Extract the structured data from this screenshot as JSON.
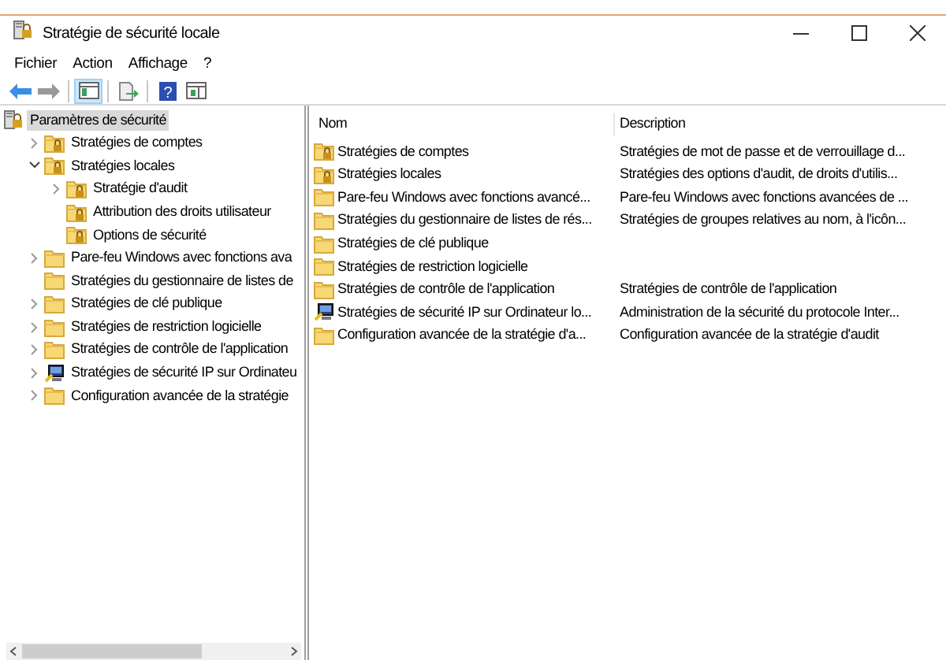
{
  "window": {
    "title": "Stratégie de sécurité locale"
  },
  "menu": [
    "Fichier",
    "Action",
    "Affichage",
    "?"
  ],
  "toolbar": [
    [
      {
        "kind": "back",
        "enabled": true,
        "pressed": false
      },
      {
        "kind": "forward",
        "enabled": false,
        "pressed": false
      }
    ],
    [
      {
        "kind": "tree",
        "enabled": true,
        "pressed": true
      }
    ],
    [
      {
        "kind": "export",
        "enabled": true,
        "pressed": false
      }
    ],
    [
      {
        "kind": "help",
        "label": "?",
        "enabled": true,
        "pressed": false
      },
      {
        "kind": "panel",
        "enabled": true,
        "pressed": false
      }
    ]
  ],
  "tree": {
    "label": "Paramètres de sécurité",
    "kind": "security",
    "selected": true,
    "children": [
      {
        "label": "Stratégies de comptes",
        "kind": "locked",
        "selected": false,
        "expanded": false
      },
      {
        "label": "Stratégies locales",
        "kind": "locked",
        "selected": false,
        "expanded": true,
        "children": [
          {
            "label": "Stratégie d'audit",
            "kind": "locked",
            "selected": false,
            "expanded": false
          },
          {
            "label": "Attribution des droits utilisateur",
            "kind": "locked",
            "selected": false
          },
          {
            "label": "Options de sécurité",
            "kind": "locked",
            "selected": false
          }
        ]
      },
      {
        "label": "Pare-feu Windows avec fonctions ava",
        "kind": "folder",
        "selected": false,
        "expanded": false
      },
      {
        "label": "Stratégies du gestionnaire de listes de",
        "kind": "folder",
        "selected": false
      },
      {
        "label": "Stratégies de clé publique",
        "kind": "folder",
        "selected": false,
        "expanded": false
      },
      {
        "label": "Stratégies de restriction logicielle",
        "kind": "folder",
        "selected": false,
        "expanded": false
      },
      {
        "label": "Stratégies de contrôle de l'application",
        "kind": "folder",
        "selected": false,
        "expanded": false
      },
      {
        "label": "Stratégies de sécurité IP sur Ordinateu",
        "kind": "computer",
        "selected": false,
        "expanded": false
      },
      {
        "label": "Configuration avancée de la stratégie",
        "kind": "folder",
        "selected": false,
        "expanded": false
      }
    ]
  },
  "list": {
    "columns": [
      "Nom",
      "Description"
    ],
    "rows": [
      {
        "kind": "locked",
        "name": "Stratégies de comptes",
        "description": "Stratégies de mot de passe et de verrouillage d..."
      },
      {
        "kind": "locked",
        "name": "Stratégies locales",
        "description": "Stratégies des options d'audit, de droits d'utilis..."
      },
      {
        "kind": "folder",
        "name": "Pare-feu Windows avec fonctions avancé...",
        "description": "Pare-feu Windows avec fonctions avancées de ..."
      },
      {
        "kind": "folder",
        "name": "Stratégies du gestionnaire de listes de rés...",
        "description": "Stratégies de groupes relatives au nom, à l'icôn..."
      },
      {
        "kind": "folder",
        "name": "Stratégies de clé publique"
      },
      {
        "kind": "folder",
        "name": "Stratégies de restriction logicielle"
      },
      {
        "kind": "folder",
        "name": "Stratégies de contrôle de l'application",
        "description": "Stratégies de contrôle de l'application"
      },
      {
        "kind": "computer",
        "name": "Stratégies de sécurité IP sur Ordinateur lo...",
        "description": "Administration de la sécurité du protocole Inter..."
      },
      {
        "kind": "folder",
        "name": "Configuration avancée de la stratégie d'a...",
        "description": "Configuration avancée de la stratégie d'audit"
      }
    ]
  }
}
